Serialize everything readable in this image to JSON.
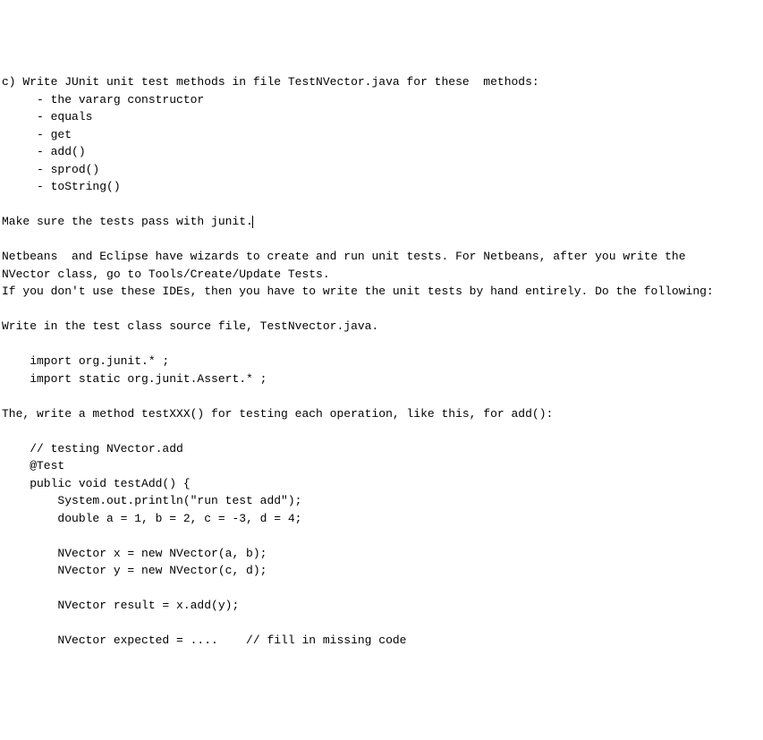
{
  "lines": {
    "l1": "c) Write JUnit unit test methods in file TestNVector.java for these  methods:",
    "l2": "     - the vararg constructor",
    "l3": "     - equals",
    "l4": "     - get",
    "l5": "     - add()",
    "l6": "     - sprod()",
    "l7": "     - toString()",
    "l8": "",
    "l9a": "Make sure the tests pass with junit.",
    "l10": "",
    "l11": "Netbeans  and Eclipse have wizards to create and run unit tests. For Netbeans, after you write the",
    "l12": "NVector class, go to Tools/Create/Update Tests.",
    "l13": "If you don't use these IDEs, then you have to write the unit tests by hand entirely. Do the following:",
    "l14": "",
    "l15": "Write in the test class source file, TestNvector.java.",
    "l16": "",
    "l17": "    import org.junit.* ;",
    "l18": "    import static org.junit.Assert.* ;",
    "l19": "",
    "l20": "The, write a method testXXX() for testing each operation, like this, for add():",
    "l21": "",
    "l22": "    // testing NVector.add",
    "l23": "    @Test",
    "l24": "    public void testAdd() {",
    "l25": "        System.out.println(\"run test add\");",
    "l26": "        double a = 1, b = 2, c = -3, d = 4;",
    "l27": "",
    "l28": "        NVector x = new NVector(a, b);",
    "l29": "        NVector y = new NVector(c, d);",
    "l30": "",
    "l31": "        NVector result = x.add(y);",
    "l32": "",
    "l33": "        NVector expected = ....    // fill in missing code"
  }
}
